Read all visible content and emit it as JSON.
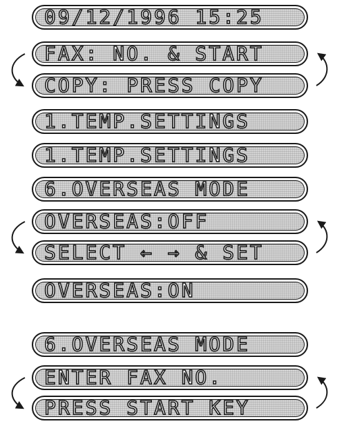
{
  "screens": [
    {
      "text": "09/12/1996 15:25"
    },
    {
      "text": "FAX: NO. & START"
    },
    {
      "text": "COPY: PRESS COPY"
    },
    {
      "text": "1.TEMP.SETTINGS"
    },
    {
      "text": "1.TEMP.SETTINGS"
    },
    {
      "text": "6.OVERSEAS MODE"
    },
    {
      "text": "OVERSEAS:OFF"
    },
    {
      "text": "SELECT ← → & SET"
    },
    {
      "text": "OVERSEAS:ON"
    },
    {
      "text": "6.OVERSEAS MODE"
    },
    {
      "text": "ENTER FAX NO."
    },
    {
      "text": "PRESS START KEY"
    }
  ],
  "colors": {
    "outline": "#1a1a1a",
    "screen": "#d4d4d4",
    "glyph": "#ffffff"
  },
  "icons": {
    "alternating_display": "alternating-display-arrows-icon"
  }
}
